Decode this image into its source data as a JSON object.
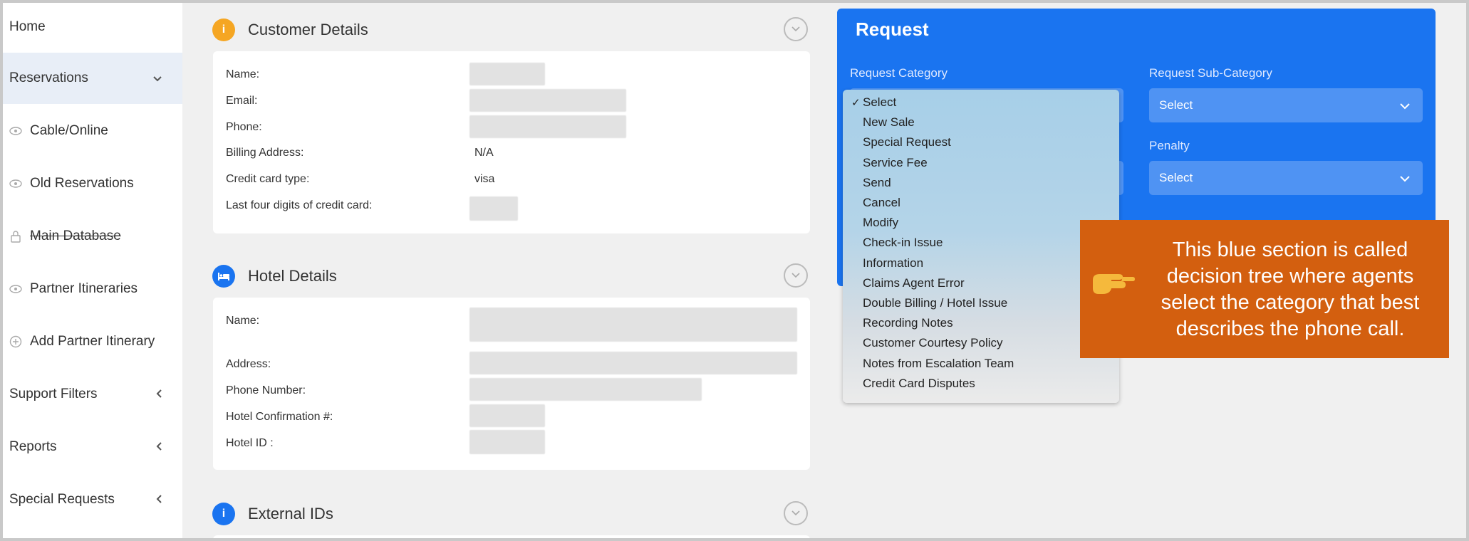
{
  "sidebar": {
    "home": "Home",
    "reservations": "Reservations",
    "cable_online": "Cable/Online",
    "old_reservations": "Old Reservations",
    "main_database": "Main Database",
    "partner_itineraries": "Partner Itineraries",
    "add_partner_itinerary": "Add Partner Itinerary",
    "support_filters": "Support Filters",
    "reports": "Reports",
    "special_requests": "Special Requests"
  },
  "customer": {
    "title": "Customer Details",
    "name_label": "Name:",
    "email_label": "Email:",
    "phone_label": "Phone:",
    "billing_label": "Billing Address:",
    "billing_value": "N/A",
    "card_type_label": "Credit card type:",
    "card_type_value": "visa",
    "last_four_label": "Last four digits of credit card:"
  },
  "hotel": {
    "title": "Hotel Details",
    "name_label": "Name:",
    "address_label": "Address:",
    "phone_label": "Phone Number:",
    "confirmation_label": "Hotel Confirmation #:",
    "id_label": "Hotel ID :"
  },
  "external": {
    "title": "External IDs"
  },
  "request": {
    "title": "Request",
    "category_label": "Request Category",
    "subcategory_label": "Request Sub-Category",
    "subcategory_value": "Select",
    "penalty_label": "Penalty",
    "penalty_value": "Select"
  },
  "dropdown": {
    "selected_index": 0,
    "options": [
      "Select",
      "New Sale",
      "Special Request",
      "Service Fee",
      "Send",
      "Cancel",
      "Modify",
      "Check-in Issue",
      "Information",
      "Claims Agent Error",
      "Double Billing / Hotel Issue",
      "Recording Notes",
      "Customer Courtesy Policy",
      "Notes from Escalation Team",
      "Credit Card Disputes"
    ]
  },
  "callout": {
    "text": "This blue section is called decision tree where agents select the category that best describes the phone call."
  },
  "colors": {
    "request_panel": "#1a74f0",
    "callout": "#d35f0f",
    "customer_badge": "#f5a623",
    "hotel_badge": "#1a74f0"
  }
}
